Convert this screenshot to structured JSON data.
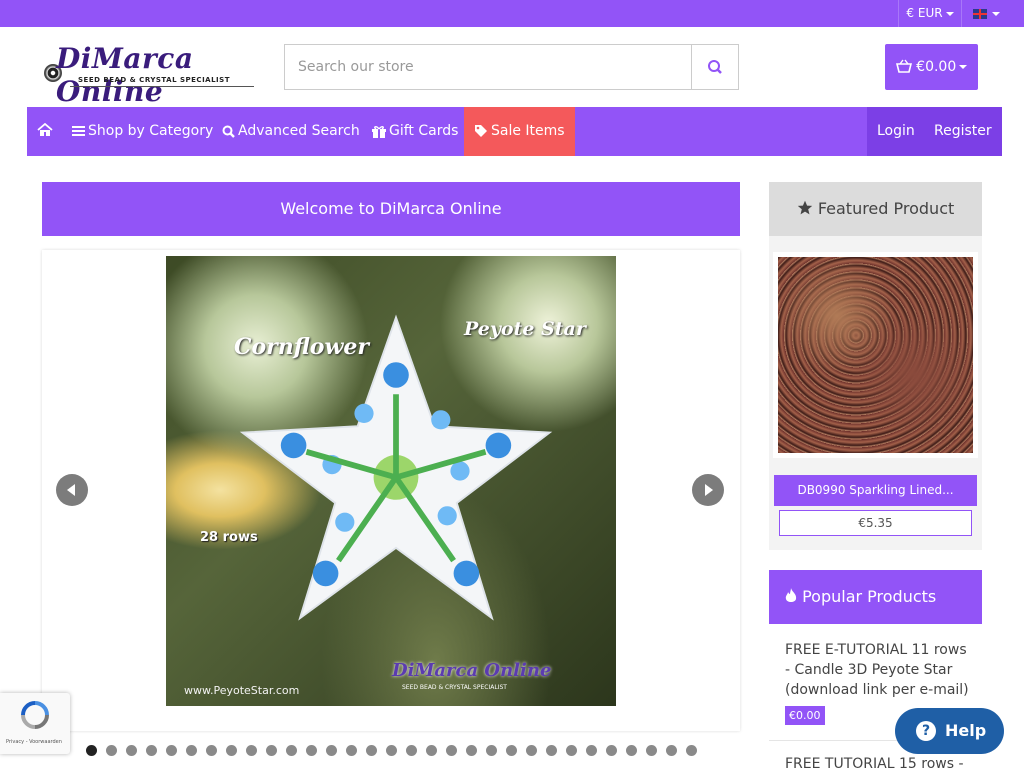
{
  "topbar": {
    "currency": "€ EUR",
    "language_icon": "uk-flag-icon"
  },
  "header": {
    "logo_name": "DiMarca Online",
    "logo_tagline": "SEED BEAD & CRYSTAL SPECIALIST",
    "search_placeholder": "Search our store",
    "cart_total": "€0.00"
  },
  "nav": {
    "home_icon": "home-icon",
    "items": [
      {
        "label": "Shop by Category",
        "icon": "bars-icon"
      },
      {
        "label": "Advanced Search",
        "icon": "search-icon"
      },
      {
        "label": "Gift Cards",
        "icon": "gift-icon"
      },
      {
        "label": "Sale Items",
        "icon": "tag-icon"
      }
    ],
    "login": "Login",
    "register": "Register"
  },
  "main": {
    "welcome": "Welcome to DiMarca Online",
    "slide": {
      "title_left": "Cornflower",
      "title_right": "Peyote Star",
      "rows_label": "28 rows",
      "url_watermark": "www.PeyoteStar.com",
      "watermark_logo": "DiMarca Online",
      "watermark_tagline": "SEED BEAD & CRYSTAL SPECIALIST"
    },
    "slide_count": 31,
    "active_slide": 1
  },
  "sidebar": {
    "featured_title": "Featured Product",
    "featured_product": {
      "name": "DB0990 Sparkling Lined...",
      "price": "€5.35"
    },
    "popular_title": "Popular Products",
    "popular_items": [
      {
        "name": "FREE E-TUTORIAL 11 rows - Candle 3D Peyote Star (download link per e-mail)",
        "price": "€0.00"
      },
      {
        "name": "FREE TUTORIAL 15 rows -"
      }
    ]
  },
  "widgets": {
    "recaptcha_text": "Privacy - Voorwaarden",
    "help_label": "Help"
  },
  "colors": {
    "brand": "#9254f7",
    "sale": "#f4595b",
    "help": "#1f5fa6"
  }
}
